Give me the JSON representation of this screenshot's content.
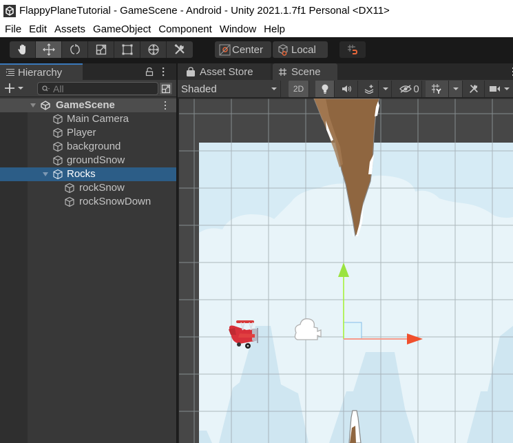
{
  "window": {
    "title": "FlappyPlaneTutorial - GameScene - Android - Unity 2021.1.7f1 Personal <DX11>",
    "logo_icon": "unity-logo-icon"
  },
  "menu": [
    "File",
    "Edit",
    "Assets",
    "GameObject",
    "Component",
    "Window",
    "Help"
  ],
  "toolbar": {
    "tools": [
      {
        "name": "hand-tool",
        "icon": "hand-icon",
        "active": false
      },
      {
        "name": "move-tool",
        "icon": "move-arrows-icon",
        "active": true
      },
      {
        "name": "rotate-tool",
        "icon": "rotate-icon",
        "active": false
      },
      {
        "name": "scale-tool",
        "icon": "scale-icon",
        "active": false
      },
      {
        "name": "rect-tool",
        "icon": "rect-transform-icon",
        "active": false
      },
      {
        "name": "transform-tool",
        "icon": "transform-icon",
        "active": false
      },
      {
        "name": "custom-tool",
        "icon": "wrench-screwdriver-icon",
        "active": false
      }
    ],
    "pivot_label": "Center",
    "space_label": "Local",
    "snap_icon": "grid-snap-icon"
  },
  "hierarchy": {
    "tab_label": "Hierarchy",
    "search_placeholder": "All",
    "scene": "GameScene",
    "items": [
      {
        "label": "Main Camera",
        "depth": 1,
        "expandable": false,
        "selected": false
      },
      {
        "label": "Player",
        "depth": 1,
        "expandable": false,
        "selected": false
      },
      {
        "label": "background",
        "depth": 1,
        "expandable": false,
        "selected": false
      },
      {
        "label": "groundSnow",
        "depth": 1,
        "expandable": false,
        "selected": false
      },
      {
        "label": "Rocks",
        "depth": 1,
        "expandable": true,
        "expanded": true,
        "selected": true
      },
      {
        "label": "rockSnow",
        "depth": 2,
        "expandable": false,
        "selected": false
      },
      {
        "label": "rockSnowDown",
        "depth": 2,
        "expandable": false,
        "selected": false
      }
    ]
  },
  "scene_panel": {
    "tabs": [
      {
        "label": "Asset Store",
        "icon": "shopping-bag-icon",
        "active": false
      },
      {
        "label": "Scene",
        "icon": "grid-hash-icon",
        "active": true
      }
    ],
    "draw_mode": "Shaded",
    "mode_2d_label": "2D",
    "hidden_count": "0",
    "colors": {
      "sky": "#d6ebf5",
      "cloud": "#e8f4f9",
      "mountain": "#cfe6f1",
      "rock_brown": "#8f6640",
      "gizmo_x": "#f0502d",
      "gizmo_y": "#a6f03c",
      "grid": "#9aa3a8",
      "selection": "#2c5d87"
    }
  }
}
